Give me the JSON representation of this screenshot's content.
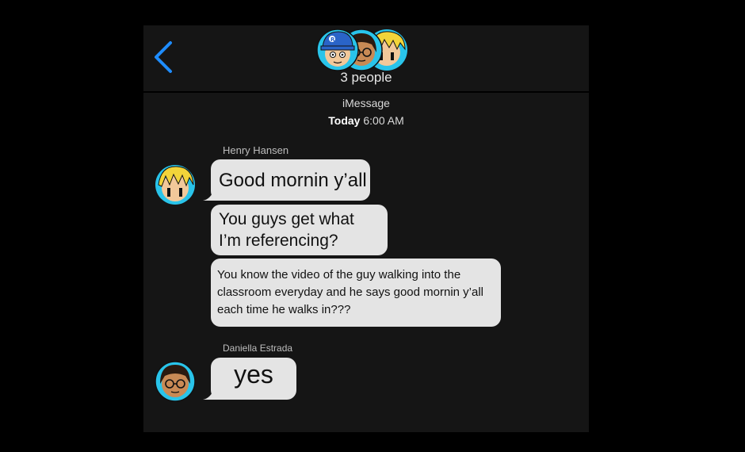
{
  "header": {
    "back_icon": "chevron-left-icon",
    "group_name": "3 people",
    "participants": [
      "blue-cap-boy-avatar",
      "glasses-girl-avatar",
      "blonde-boy-avatar"
    ]
  },
  "thread": {
    "service": "iMessage",
    "date_label": "Today",
    "time_label": "6:00 AM"
  },
  "groups": [
    {
      "sender": "Henry Hansen",
      "avatar_icon": "blonde-boy-avatar",
      "messages": [
        "Good mornin y’all",
        "You guys get what I’m referencing?",
        "You know the video of the guy walking into the classroom everyday and he says good mornin y’all each time he walks in???"
      ]
    },
    {
      "sender": "Daniella Estrada",
      "avatar_icon": "glasses-girl-avatar",
      "messages": [
        "yes"
      ]
    }
  ],
  "colors": {
    "accent": "#1e8cff",
    "bubble": "#e4e4e4",
    "background": "#151515",
    "avatar_ring": "#29c4ea"
  }
}
